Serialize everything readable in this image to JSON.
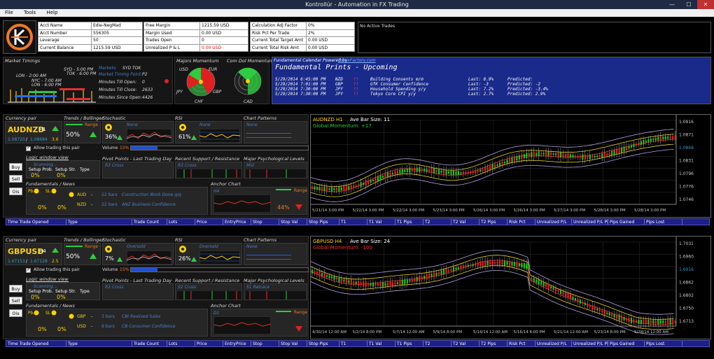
{
  "window": {
    "title": "Kontrollúr - Automation in FX Trading",
    "min": "—",
    "max": "☐",
    "close": "✕"
  },
  "menu": [
    "File",
    "Tools",
    "Help"
  ],
  "account": {
    "col1": [
      [
        "Acct Name",
        "Edie-NegMad"
      ],
      [
        "Acct Number",
        "556305"
      ],
      [
        "Leverage",
        "50"
      ],
      [
        "Current Balance",
        "1215.59 USD"
      ]
    ],
    "col2": [
      [
        "Free Margin",
        "1215.59 USD"
      ],
      [
        "Margin Used",
        "0.00 USD"
      ],
      [
        "Trades Open",
        "0"
      ],
      [
        "Unrealized P & L",
        "0.00 USD"
      ]
    ],
    "col3": [
      [
        "Calculation Adj Factor",
        "0%"
      ],
      [
        "Risk Pct Per Trade",
        "2%"
      ],
      [
        "Current Total Target Amt",
        "0.00 USD"
      ],
      [
        "Current Total Risk Amt",
        "0.00 USD"
      ]
    ],
    "no_trades": "No Active Trades"
  },
  "timings": {
    "title": "Market Timings",
    "syd": "SYD - 5:00 PM",
    "tok": "TOK - 6:00 PM",
    "lon": "LON - 2:00 AM",
    "nyc": "NYC - 7:00 AM",
    "lon2": "LON - 6:00 PM",
    "markets_lbl": "Markets:",
    "markets_val": "SYD TOK",
    "point_lbl": "Market Timing Point:",
    "point_val": "P2",
    "open_lbl": "Minutes Till Open:",
    "open_val": "0",
    "close_lbl": "Minutes Till Close:",
    "close_val": "2633",
    "since_lbl": "Minutes Since Open:",
    "since_val": "4426"
  },
  "momentum": {
    "majors": "Majors Momentum",
    "combo": "Com Dol Momentum",
    "usd": "USD",
    "eur": "EUR",
    "jpy": "JPY",
    "gbp": "GBP",
    "chf": "CHF",
    "cad": "CAD"
  },
  "calendar": {
    "powered": "Fundamental Calendar Powered by",
    "site": "ForexFactory.com",
    "title": "Fundamental Prints - Upcoming",
    "rows": [
      [
        "5/29/2014 6:45:00 PM",
        "NZD",
        "!!",
        "Building Consents m/m",
        "Last: 8.9%",
        "Predicted:"
      ],
      [
        "5/29/2014 7:01:00 PM",
        "GBP",
        "!!",
        "GfK Consumer Confidence",
        "Last: -3",
        "Predicted: -2"
      ],
      [
        "5/29/2014 7:30:00 PM",
        "JPY",
        "!!",
        "Household Spending y/y",
        "Last: 7.2%",
        "Predicted: -3.4%"
      ],
      [
        "5/29/2014 7:30:00 PM",
        "JPY",
        "!!",
        "Tokyo Core CPI y/y",
        "Last: 2.7%",
        "Predicted: 2.9%"
      ]
    ]
  },
  "labels": {
    "currency_pair": "Currency pair",
    "trends": "Trends / Bollinger",
    "stochastic": "Stochastic",
    "rsi": "RSI",
    "patterns": "Chart Patterns",
    "volume": "Volume",
    "allow": "Allow trading this pair",
    "logic": "Logic window view",
    "scanning": "Scanning...",
    "setup_prob": "Setup Prob.",
    "setup_str": "Setup Str.",
    "type": "Type",
    "buy": "Buy",
    "sell": "Sell",
    "ois": "Ois",
    "pivot": "Pivot Points - Last Trading Day",
    "support": "Recent Support / Resistance",
    "psych": "Major Psychological Levels",
    "fund": "Fundamentals / News",
    "anchor": "Anchor Chart",
    "range": "Range",
    "pb": "Pb.",
    "sl": "SL"
  },
  "trade_cols": [
    "Time Trade Opened",
    "Type",
    "Trade Count",
    "Lots",
    "Price",
    "EntryPrice",
    "Stop",
    "Stop Val",
    "Stop Pips",
    "T1",
    "T1 Val",
    "T1 Pips",
    "T2",
    "T2 Val",
    "T2 Pips",
    "Risk Pct",
    "Unrealized P/L",
    "Unrealized P/L Pips",
    "Pips Gained",
    "Pips Lost"
  ],
  "pairs": [
    {
      "pair": "AUDNZD",
      "tf": "H1",
      "bid": "1.08720",
      "ask": "1.08684",
      "spread": "3.6",
      "trend": "50%",
      "stoch": "36%",
      "stoch_state": "None",
      "rsi": "61%",
      "rsi_state": "None",
      "pattern": "None",
      "volume": "15%",
      "setup_prob": "0%",
      "setup_str": "0%",
      "pivot": "R3 Cross",
      "support": "R3 Cross",
      "psych": "Mid",
      "anchor_tf": "H4",
      "anchor_pct": "44%",
      "news": [
        {
          "ccy": "AUD",
          "bars": "22 bars",
          "event": "Construction Work Done q/q"
        },
        {
          "ccy": "NZD",
          "bars": "22 bars",
          "event": "ANZ Business Confidence"
        }
      ],
      "pb": "0%",
      "sl": "0%",
      "chart_title": "AUDNZD H1",
      "ave_bar": "Ave Bar Size: 11",
      "momentum": "Global Momentum: +17",
      "yticks": [
        "1.0916",
        "1.0871",
        "1.0868",
        "1.0831",
        "1.0796",
        "1.0776",
        "1.0746"
      ],
      "xticks": [
        "5/21/14 3:00 PM",
        "5/22/14 3:00 PM",
        "5/22/14 3:00 PM",
        "5/23/14 3:00 PM",
        "5/26/14 3:00 PM",
        "5/26/14 3:00 PM",
        "5/27/14 3:00 PM",
        "5/28/14 3:00 PM",
        "5/28/14 3:00 PM"
      ]
    },
    {
      "pair": "GBPUSD",
      "tf": "H4",
      "bid": "1.67153",
      "ask": "1.67128",
      "spread": "2.5",
      "trend": "50%",
      "stoch": "7%",
      "stoch_state": "Oversold",
      "rsi": "26%",
      "rsi_state": "Oversold",
      "pattern": "None",
      "volume": "15%",
      "setup_prob": "0%",
      "setup_str": "0%",
      "pivot": "R3 Cross",
      "support": "S2 Cross",
      "psych": "S1 Retrace",
      "anchor_tf": "D1",
      "anchor_pct": "",
      "news": [
        {
          "ccy": "GBP",
          "bars": "3 bars",
          "event": "CBI Realized Sales"
        },
        {
          "ccy": "USD",
          "bars": "8 bars",
          "event": "CB Consumer Confidence"
        }
      ],
      "pb": "0%",
      "sl": "0%",
      "chart_title": "GBPUSD H4",
      "ave_bar": "Ave Bar Size: 24",
      "momentum": "Global Momentum: -100",
      "yticks": [
        "1.7031",
        "1.6960",
        "1.6916",
        "1.6862",
        "1.6802",
        "1.6750",
        "1.6713"
      ],
      "xticks": [
        "4/30/14 12:00 AM",
        "5/2/14 8:00 PM",
        "5/7/14 12:00 AM",
        "5/9/14 8:00 PM",
        "5/14/14 12:00 AM",
        "5/16/14 8:00 PM",
        "5/21/14 12:00 AM",
        "5/23/14 8:00 PM",
        "5/28/14 12:00 AM"
      ]
    }
  ]
}
